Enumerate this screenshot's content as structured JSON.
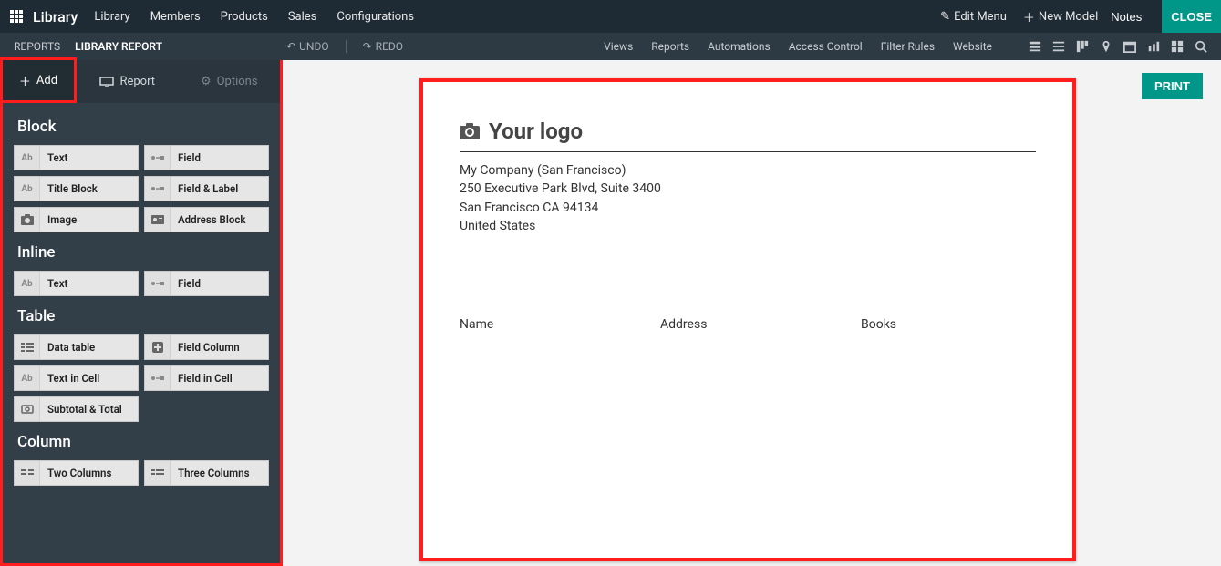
{
  "topnav": {
    "brand": "Library",
    "items": [
      "Library",
      "Members",
      "Products",
      "Sales",
      "Configurations"
    ],
    "edit_menu": "Edit Menu",
    "new_model": "New Model",
    "notes": "Notes",
    "close": "CLOSE"
  },
  "subnav": {
    "crumb1": "REPORTS",
    "crumb2": "LIBRARY REPORT",
    "undo": "UNDO",
    "redo": "REDO",
    "links": [
      "Views",
      "Reports",
      "Automations",
      "Access Control",
      "Filter Rules",
      "Website"
    ]
  },
  "left": {
    "tab_add": "Add",
    "tab_report": "Report",
    "tab_options": "Options",
    "sections": {
      "block": {
        "title": "Block",
        "items": [
          "Text",
          "Field",
          "Title Block",
          "Field & Label",
          "Image",
          "Address Block"
        ]
      },
      "inline": {
        "title": "Inline",
        "items": [
          "Text",
          "Field"
        ]
      },
      "table": {
        "title": "Table",
        "items": [
          "Data table",
          "Field Column",
          "Text in Cell",
          "Field in Cell",
          "Subtotal & Total"
        ]
      },
      "column": {
        "title": "Column",
        "items": [
          "Two Columns",
          "Three Columns"
        ]
      }
    }
  },
  "report": {
    "logo_text": "Your logo",
    "company_name": "My Company (San Francisco)",
    "address_line1": "250 Executive Park Blvd, Suite 3400",
    "address_line2": "San Francisco CA 94134",
    "address_country": "United States",
    "cols": [
      "Name",
      "Address",
      "Books"
    ]
  },
  "print": "PRINT"
}
